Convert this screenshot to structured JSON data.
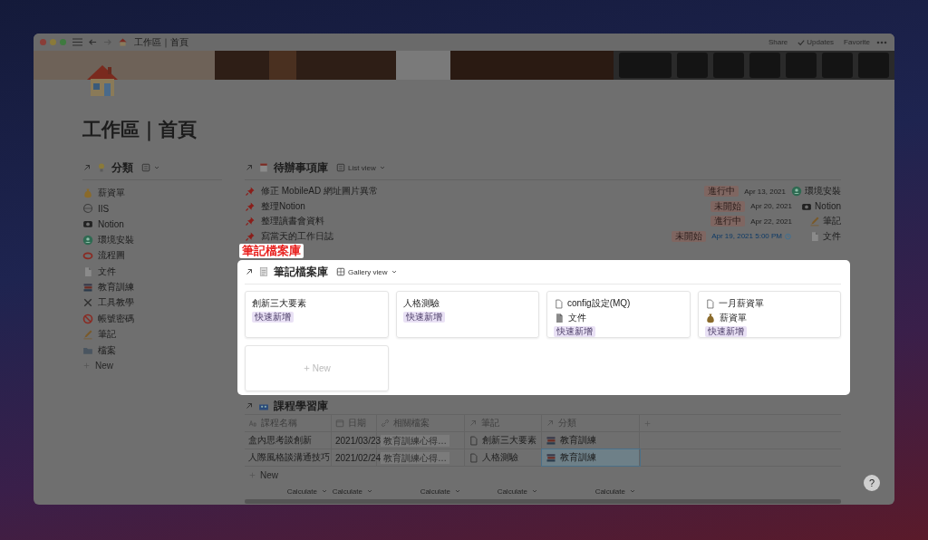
{
  "window": {
    "breadcrumb": "工作區｜首頁",
    "actions": [
      {
        "label": "Share",
        "kind": "text"
      },
      {
        "label": "Updates",
        "kind": "check"
      },
      {
        "label": "Favorite",
        "kind": "text"
      }
    ]
  },
  "page": {
    "title": "工作區｜首頁"
  },
  "categories": {
    "title": "分類",
    "items": [
      "薪資單",
      "IIS",
      "Notion",
      "環境安裝",
      "流程圖",
      "文件",
      "教育訓練",
      "工具教學",
      "帳號密碼",
      "筆記",
      "檔案"
    ],
    "new_label": "New"
  },
  "todo": {
    "title": "待辦事項庫",
    "view": "List view",
    "rows": [
      {
        "title": "修正 MobileAD 網址圖片異常",
        "status": "進行中",
        "date": "Apr 13, 2021",
        "reminder": false,
        "category": "環境安裝"
      },
      {
        "title": "整理Notion",
        "status": "未開始",
        "date": "Apr 20, 2021",
        "reminder": false,
        "category": "Notion"
      },
      {
        "title": "整理讀書會資料",
        "status": "進行中",
        "date": "Apr 22, 2021",
        "reminder": false,
        "category": "筆記"
      },
      {
        "title": "寫當天的工作日誌",
        "status": "未開始",
        "date": "Apr 19, 2021 5:00 PM",
        "reminder": true,
        "category": "文件"
      }
    ]
  },
  "callout": {
    "label": "筆記檔案庫"
  },
  "gallery": {
    "title": "筆記檔案庫",
    "view": "Gallery view",
    "cards": [
      {
        "title": "創新三大要素",
        "tag": "快速新增"
      },
      {
        "title": "人格測驗",
        "tag": "快速新增"
      },
      {
        "title": "config設定(MQ)",
        "category": "文件",
        "tag": "快速新增"
      },
      {
        "title": "一月薪資單",
        "category": "薪資單",
        "tag": "快速新增"
      }
    ],
    "new_label": "New"
  },
  "table": {
    "title": "課程學習庫",
    "columns": [
      "課程名稱",
      "日期",
      "相關檔案",
      "筆記",
      "分類"
    ],
    "rows": [
      {
        "name": "盒內思考談創新",
        "date": "2021/03/23",
        "files": "教育訓練心得…",
        "note": "創新三大要素",
        "category": "教育訓練",
        "selected": false
      },
      {
        "name": "人際風格談溝通技巧",
        "date": "2021/02/24",
        "files": "教育訓練心得…",
        "note": "人格測驗",
        "category": "教育訓練",
        "selected": true
      }
    ],
    "new_label": "New",
    "footer": [
      "Calculate",
      "Calculate",
      "Calculate",
      "Calculate",
      "Calculate"
    ]
  },
  "help": "?"
}
